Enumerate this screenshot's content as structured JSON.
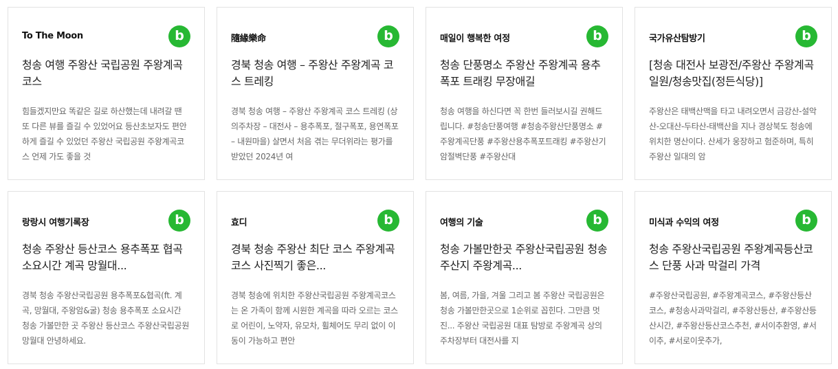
{
  "cards": [
    {
      "blog": "To The Moon",
      "badge": "b",
      "title": "청송 여행 주왕산 국립공원 주왕계곡코스",
      "snippet": "힘들겠지만요 똑같은 길로 하산했는데 내려갈 땐 또 다른 뷰를 즐길 수 있었어요 등산초보자도 편안하게 즐길 수 있었던 주왕산 국립공원 주왕계곡코스 언제 가도 좋을 것"
    },
    {
      "blog": "隨緣樂命",
      "badge": "b",
      "title": "경북 청송 여행 – 주왕산 주왕계곡 코스 트레킹",
      "snippet": "경북 청송 여행 – 주왕산 주왕계곡 코스 트레킹 (상의주차장 – 대전사 – 용추폭포, 절구폭포, 용연폭포 – 내원마을) 살면서 처음 겪는 무더위라는 평가를 받았던 2024년 여"
    },
    {
      "blog": "매일이 행복한 여정",
      "badge": "b",
      "title": "청송 단풍명소 주왕산 주왕계곡 용추폭포 트래킹 무장애길",
      "snippet": "청송 여행을 하신다면 꼭 한번 들러보시길 권해드립니다. #청송단풍여행 #청송주왕산단풍명소 #주왕계곡단풍 #주왕산용추폭포트래킹 #주왕산기암절벽단풍 #주왕산대"
    },
    {
      "blog": "국가유산탐방기",
      "badge": "b",
      "title": "[청송 대전사 보광전/주왕산 주왕계곡 일원/청송맛집(정든식당)]",
      "snippet": "주왕산은 태백산맥을 타고 내려오면서 금강산-설악산-오대산-두타산-태백산을 지나 경상북도 청송에 위치한 명산이다. 산세가 웅장하고 험준하며, 특히 주왕산 일대의 암"
    },
    {
      "blog": "랑랑시 여행기록장",
      "badge": "b",
      "title": "청송 주왕산 등산코스 용추폭포 협곡 소요시간 계곡 망월대...",
      "snippet": "경북 청송 주왕산국립공원 용추폭포&협곡(ft. 계곡, 망월대, 주왕암&굴) 청송 용추폭포 소요시간 청송 가볼만한 곳 주왕산 등산코스 주왕산국립공원 망월대 안녕하세요."
    },
    {
      "blog": "효디",
      "badge": "b",
      "title": "경북 청송 주왕산 최단 코스 주왕계곡코스 사진찍기 좋은...",
      "snippet": "경북 청송에 위치한 주왕산국립공원 주왕계곡코스는 온 가족이 함께 시원한 계곡을 따라 오르는 코스로 어린이, 노약자, 유모차, 휠체어도 무리 없이 이동이 가능하고 편안"
    },
    {
      "blog": "여행의 기술",
      "badge": "b",
      "title": "청송 가볼만한곳 주왕산국립공원 청송주산지 주왕계곡...",
      "snippet": "봄, 여름, 가을, 겨울 그리고 봄 주왕산 국립공원은 청송 가볼만한곳으로 1순위로 꼽힌다. 그만큼 멋진... 주왕산 국립공원 대표 탐방로 주왕계곡 상의주차장부터 대전사를 지"
    },
    {
      "blog": "미식과 수익의 여정",
      "badge": "b",
      "title": "청송 주왕산국립공원 주왕계곡등산코스 단풍 사과 막걸리 가격",
      "snippet": "#주왕산국립공원, #주왕계곡코스, #주왕산등산코스, #청송사과막걸리, #주왕산등산, #주왕산등산시간, #주왕산등산코스추천, #서이추환영, #서이추, #서로이웃추가,"
    }
  ],
  "colors": {
    "badge": "#27b833",
    "border": "#e2e2e2",
    "snippet": "#666666"
  },
  "icons": {
    "badge": "blog-b-icon"
  }
}
